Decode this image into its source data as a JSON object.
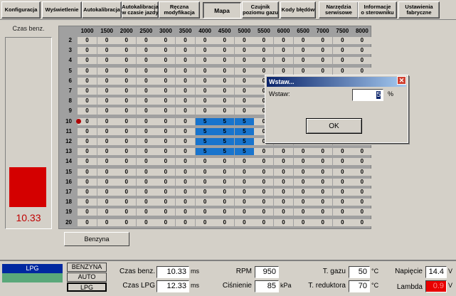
{
  "tabs": [
    {
      "label": "Konfiguracja",
      "active": false
    },
    {
      "label": "Wyświetlenie",
      "active": false
    },
    {
      "label": "Autokalibracja",
      "active": false
    },
    {
      "label": "Autokalibracja\nw czasie jazdy",
      "active": false
    },
    {
      "label": "Ręczna\nmodyfikacja",
      "active": false
    },
    {
      "label": "Mapa",
      "active": true
    },
    {
      "label": "Czujnik\npoziomu gazu",
      "active": false
    },
    {
      "label": "Kody błędów",
      "active": false
    },
    {
      "label": "Narzędzia\nserwisowe",
      "active": false
    },
    {
      "label": "Informacje\no sterowniku",
      "active": false
    },
    {
      "label": "Ustawienia\nfabryczne",
      "active": false
    }
  ],
  "gauge": {
    "label": "Czas benz.",
    "value": "10.33",
    "level": 0.4,
    "color": "#d40000"
  },
  "map": {
    "rpm_headers": [
      "1000",
      "1500",
      "2000",
      "2500",
      "3000",
      "3500",
      "4000",
      "4500",
      "5000",
      "5500",
      "6000",
      "6500",
      "7000",
      "7500",
      "8000"
    ],
    "row_headers": [
      "2",
      "3",
      "4",
      "5",
      "6",
      "7",
      "8",
      "9",
      "10",
      "11",
      "12",
      "13",
      "14",
      "15",
      "16",
      "17",
      "18",
      "19",
      "20"
    ],
    "default_value": "0",
    "selected_value": "5",
    "selected_rows": [
      "10",
      "11",
      "12",
      "13"
    ],
    "selected_cols": [
      "4000",
      "4500",
      "5000"
    ],
    "marker_row": "10",
    "selection_color": "#1874cd"
  },
  "benzyna_button": "Benzyna",
  "dialog": {
    "title": "Wstaw...",
    "label": "Wstaw:",
    "value": "5",
    "unit": "%",
    "ok": "OK"
  },
  "status": {
    "fuel_indicator": "LPG",
    "fuel_modes": [
      {
        "label": "BENZYNA",
        "active": false
      },
      {
        "label": "AUTO",
        "active": false
      },
      {
        "label": "LPG",
        "active": true
      }
    ],
    "czas_benz": {
      "label": "Czas benz.",
      "value": "10.33",
      "unit": "ms"
    },
    "czas_lpg": {
      "label": "Czas LPG",
      "value": "12.33",
      "unit": "ms"
    },
    "rpm": {
      "label": "RPM",
      "value": "950"
    },
    "cisnienie": {
      "label": "Ciśnienie",
      "value": "85",
      "unit": "kPa"
    },
    "t_gazu": {
      "label": "T. gazu",
      "value": "50",
      "unit": "°C"
    },
    "t_reduktora": {
      "label": "T. reduktora",
      "value": "70",
      "unit": "°C"
    },
    "napiecie": {
      "label": "Napięcie",
      "value": "14.4",
      "unit": "V"
    },
    "lambda": {
      "label": "Lambda",
      "value": "0.9",
      "unit": "V"
    }
  }
}
